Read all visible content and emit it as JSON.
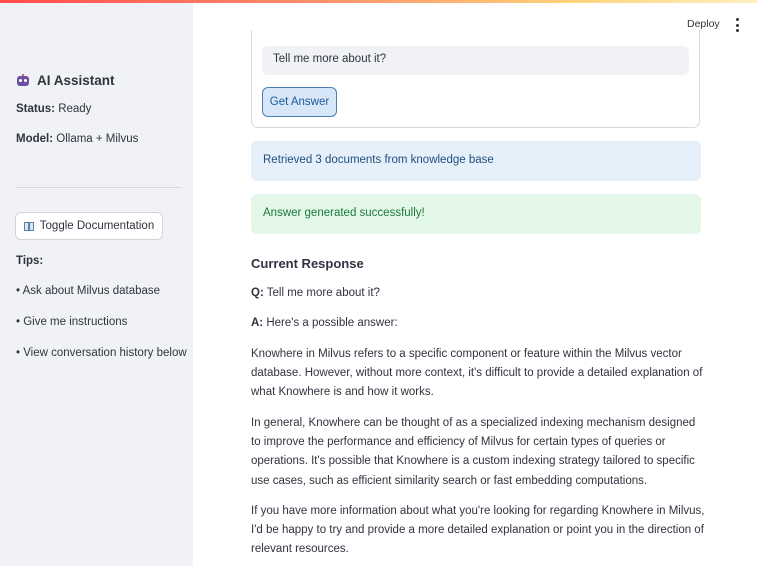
{
  "header": {
    "deploy_label": "Deploy",
    "menu_icon": "kebab-menu-icon"
  },
  "sidebar": {
    "title": "AI Assistant",
    "title_icon": "robot-icon",
    "status_label": "Status:",
    "status_value": "Ready",
    "model_label": "Model:",
    "model_value": "Ollama + Milvus",
    "toggle_label": "Toggle Documentation",
    "toggle_icon": "book-icon",
    "tips_title": "Tips:",
    "tips": [
      "• Ask about Milvus database",
      "• Give me instructions",
      "• View conversation history below"
    ]
  },
  "form": {
    "question_value": "Tell me more about it?",
    "submit_label": "Get Answer"
  },
  "alerts": {
    "info": "Retrieved 3 documents from knowledge base",
    "success": "Answer generated successfully!"
  },
  "response": {
    "title": "Current Response",
    "q_label": "Q:",
    "q_text": "Tell me more about it?",
    "a_label": "A:",
    "a_text": "Here's a possible answer:",
    "paragraphs": [
      "Knowhere in Milvus refers to a specific component or feature within the Milvus vector database. However, without more context, it's difficult to provide a detailed explanation of what Knowhere is and how it works.",
      "In general, Knowhere can be thought of as a specialized indexing mechanism designed to improve the performance and efficiency of Milvus for certain types of queries or operations. It's possible that Knowhere is a custom indexing strategy tailored to specific use cases, such as efficient similarity search or fast embedding computations.",
      "If you have more information about what you're looking for regarding Knowhere in Milvus, I'd be happy to try and provide a more detailed explanation or point you in the direction of relevant resources."
    ]
  },
  "colors": {
    "sidebar_bg": "#f0f2f6",
    "info_bg": "#e6f0fb",
    "success_bg": "#e3f7e9",
    "accent": "#ff4b4b"
  }
}
